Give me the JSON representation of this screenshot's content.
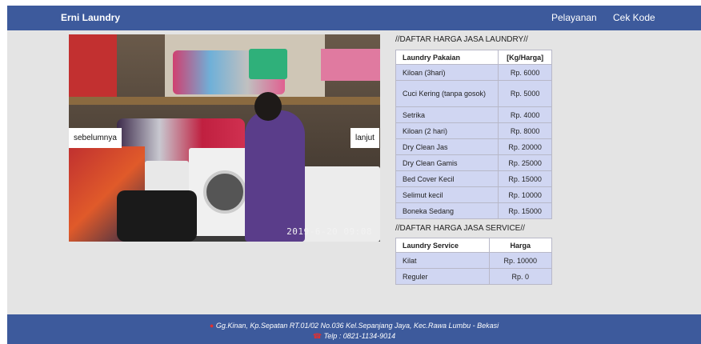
{
  "navbar": {
    "brand": "Erni Laundry",
    "links": [
      "Pelayanan",
      "Cek Kode"
    ]
  },
  "carousel": {
    "prev_label": "sebelumnya",
    "next_label": "lanjut",
    "timestamp": "2019-6-20 09:08"
  },
  "laundry_prices": {
    "heading": "//DAFTAR HARGA JASA LAUNDRY//",
    "headers": [
      "Laundry Pakaian",
      "[Kg/Harga]"
    ],
    "rows": [
      [
        "Kiloan (3hari)",
        "Rp. 6000"
      ],
      [
        "Cuci Kering (tanpa gosok)",
        "Rp. 5000"
      ],
      [
        "Setrika",
        "Rp. 4000"
      ],
      [
        "Kiloan (2 hari)",
        "Rp. 8000"
      ],
      [
        "Dry Clean Jas",
        "Rp. 20000"
      ],
      [
        "Dry Clean Gamis",
        "Rp. 25000"
      ],
      [
        "Bed Cover Kecil",
        "Rp. 15000"
      ],
      [
        "Selimut kecil",
        "Rp. 10000"
      ],
      [
        "Boneka Sedang",
        "Rp. 15000"
      ]
    ]
  },
  "service_prices": {
    "heading": "//DAFTAR HARGA JASA SERVICE//",
    "headers": [
      "Laundry Service",
      "Harga"
    ],
    "rows": [
      [
        "Kilat",
        "Rp. 10000"
      ],
      [
        "Reguler",
        "Rp. 0"
      ]
    ]
  },
  "footer": {
    "address": "Gg.Kinan, Kp.Sepatan RT.01/02 No.036 Kel.Sepanjang Jaya, Kec.Rawa Lumbu - Bekasi",
    "phone": "Telp : 0821-1134-9014"
  },
  "colors": {
    "navbar": "#3d5a9c",
    "table_cell": "#d0d6f2",
    "page_bg": "#e4e4e4"
  }
}
